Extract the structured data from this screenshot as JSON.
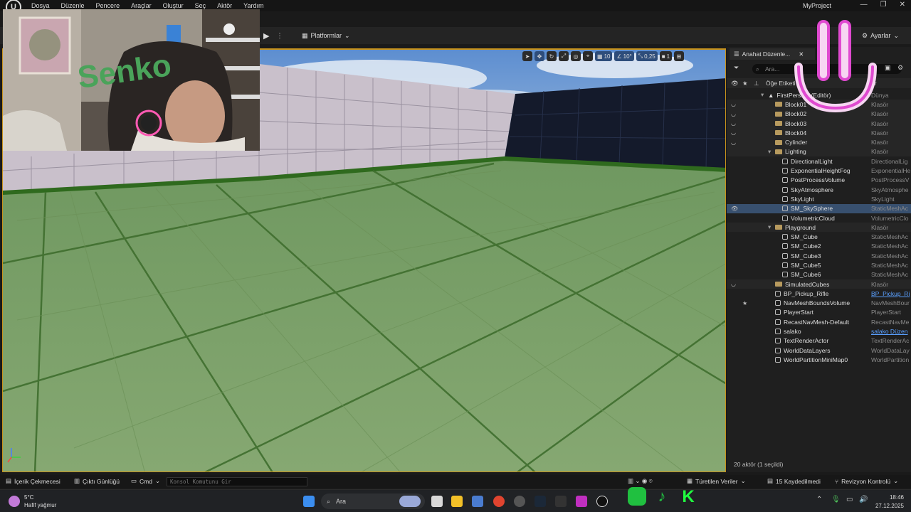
{
  "menubar": {
    "items": [
      "Dosya",
      "Düzenle",
      "Pencere",
      "Araçlar",
      "Oluştur",
      "Seç",
      "Aktör",
      "Yardım"
    ],
    "project_name": "MyProject"
  },
  "toolbar": {
    "platforms_label": "Platformlar",
    "settings_label": "Ayarlar"
  },
  "viewport_tools": {
    "grid_snap": "10",
    "rotation_snap": "10°",
    "scale_snap": "0,25",
    "camera_speed": "1"
  },
  "webcam": {
    "sign_text": "Senko"
  },
  "outliner": {
    "tab_label": "Anahat Düzenle...",
    "search_placeholder": "Ara...",
    "col_label": "Öğe Etiketi",
    "col_type": "ür",
    "rows": [
      {
        "name": "FirstPers...n (Editör)",
        "type": "Dünya",
        "kind": "world",
        "indent": 0
      },
      {
        "name": "Block01",
        "type": "Klasör",
        "kind": "folder",
        "indent": 1,
        "vis": "◡"
      },
      {
        "name": "Block02",
        "type": "Klasör",
        "kind": "folder",
        "indent": 1,
        "vis": "◡"
      },
      {
        "name": "Block03",
        "type": "Klasör",
        "kind": "folder",
        "indent": 1,
        "vis": "◡"
      },
      {
        "name": "Block04",
        "type": "Klasör",
        "kind": "folder",
        "indent": 1,
        "vis": "◡"
      },
      {
        "name": "Cylinder",
        "type": "Klasör",
        "kind": "folder",
        "indent": 1,
        "vis": "◡"
      },
      {
        "name": "Lighting",
        "type": "Klasör",
        "kind": "folder",
        "indent": 1,
        "open": true
      },
      {
        "name": "DirectionalLight",
        "type": "DirectionalLig",
        "kind": "actor",
        "indent": 2
      },
      {
        "name": "ExponentialHeightFog",
        "type": "ExponentialHe",
        "kind": "actor",
        "indent": 2
      },
      {
        "name": "PostProcessVolume",
        "type": "PostProcessV",
        "kind": "actor",
        "indent": 2
      },
      {
        "name": "SkyAtmosphere",
        "type": "SkyAtmosphe",
        "kind": "actor",
        "indent": 2
      },
      {
        "name": "SkyLight",
        "type": "SkyLight",
        "kind": "actor",
        "indent": 2
      },
      {
        "name": "SM_SkySphere",
        "type": "StaticMeshAc",
        "kind": "actor",
        "indent": 2,
        "selected": true,
        "vis": "👁"
      },
      {
        "name": "VolumetricCloud",
        "type": "VolumetricClo",
        "kind": "actor",
        "indent": 2
      },
      {
        "name": "Playground",
        "type": "Klasör",
        "kind": "folder",
        "indent": 1,
        "open": true
      },
      {
        "name": "SM_Cube",
        "type": "StaticMeshAc",
        "kind": "actor",
        "indent": 2
      },
      {
        "name": "SM_Cube2",
        "type": "StaticMeshAc",
        "kind": "actor",
        "indent": 2
      },
      {
        "name": "SM_Cube3",
        "type": "StaticMeshAc",
        "kind": "actor",
        "indent": 2
      },
      {
        "name": "SM_Cube5",
        "type": "StaticMeshAc",
        "kind": "actor",
        "indent": 2
      },
      {
        "name": "SM_Cube6",
        "type": "StaticMeshAc",
        "kind": "actor",
        "indent": 2
      },
      {
        "name": "SimulatedCubes",
        "type": "Klasör",
        "kind": "folder",
        "indent": 1,
        "vis": "◡"
      },
      {
        "name": "BP_Pickup_Rifle",
        "type": "BP_Pickup_Ri",
        "kind": "actor",
        "indent": 1,
        "link": true
      },
      {
        "name": "NavMeshBoundsVolume",
        "type": "NavMeshBour",
        "kind": "actor",
        "indent": 1,
        "star": true
      },
      {
        "name": "PlayerStart",
        "type": "PlayerStart",
        "kind": "actor",
        "indent": 1
      },
      {
        "name": "RecastNavMesh-Default",
        "type": "RecastNavMe",
        "kind": "actor",
        "indent": 1
      },
      {
        "name": "salako",
        "type": "salako Düzen",
        "kind": "actor",
        "indent": 1,
        "link": true
      },
      {
        "name": "TextRenderActor",
        "type": "TextRenderAc",
        "kind": "actor",
        "indent": 1
      },
      {
        "name": "WorldDataLayers",
        "type": "WorldDataLay",
        "kind": "actor",
        "indent": 1
      },
      {
        "name": "WorldPartitionMiniMap0",
        "type": "WorldPartition",
        "kind": "actor",
        "indent": 1
      }
    ],
    "footer": "20 aktör (1 seçildi)"
  },
  "statusbar": {
    "content_drawer": "İçerik Çekmecesi",
    "output_log": "Çıktı Günlüğü",
    "cmd": "Cmd",
    "console_placeholder": "Konsol Komutunu Gir",
    "derived_data": "Türetilen Veriler",
    "unsaved": "15 Kaydedilmedi",
    "revision": "Revizyon Kontrolü"
  },
  "taskbar": {
    "temperature": "5°C",
    "weather": "Hafif yağmur",
    "search_label": "Ara",
    "time": "18:46",
    "date": "27.12.2025"
  },
  "colors": {
    "accent": "#c7921b",
    "selection": "#38506f",
    "floor": "#7fa06a",
    "smile": "#e04ad0"
  }
}
